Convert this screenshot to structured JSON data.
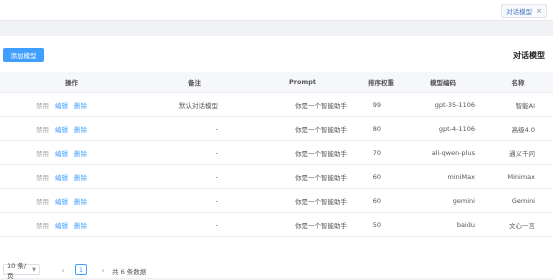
{
  "tab": {
    "label": "对话模型",
    "close": "×"
  },
  "page": {
    "title": "对话模型",
    "add_label": "添加模型"
  },
  "table": {
    "headers": {
      "op": "操作",
      "remark": "备注",
      "prompt": "Prompt",
      "sort": "排序权重",
      "code": "模型编码",
      "name": "名称"
    },
    "op_labels": {
      "disable": "禁用",
      "edit": "编辑",
      "delete": "删除"
    },
    "rows": [
      {
        "name": "智能AI",
        "code": "gpt-35-1106",
        "sort": "99",
        "prompt": "你是一个智能助手",
        "remark": "默认对话模型"
      },
      {
        "name": "高级4.0",
        "code": "gpt-4-1106",
        "sort": "80",
        "prompt": "你是一个智能助手",
        "remark": "-"
      },
      {
        "name": "通义千问",
        "code": "ali-qwen-plus",
        "sort": "70",
        "prompt": "你是一个智能助手",
        "remark": "-"
      },
      {
        "name": "Minimax",
        "code": "miniMax",
        "sort": "60",
        "prompt": "你是一个智能助手",
        "remark": "-"
      },
      {
        "name": "Gemini",
        "code": "gemini",
        "sort": "60",
        "prompt": "你是一个智能助手",
        "remark": "-"
      },
      {
        "name": "文心一言",
        "code": "baidu",
        "sort": "50",
        "prompt": "你是一个智能助手",
        "remark": "-"
      }
    ]
  },
  "pagination": {
    "page_size": "10 条/页",
    "current_page": "1",
    "total": "共 6 条数据",
    "prev": "‹",
    "next": "›"
  }
}
